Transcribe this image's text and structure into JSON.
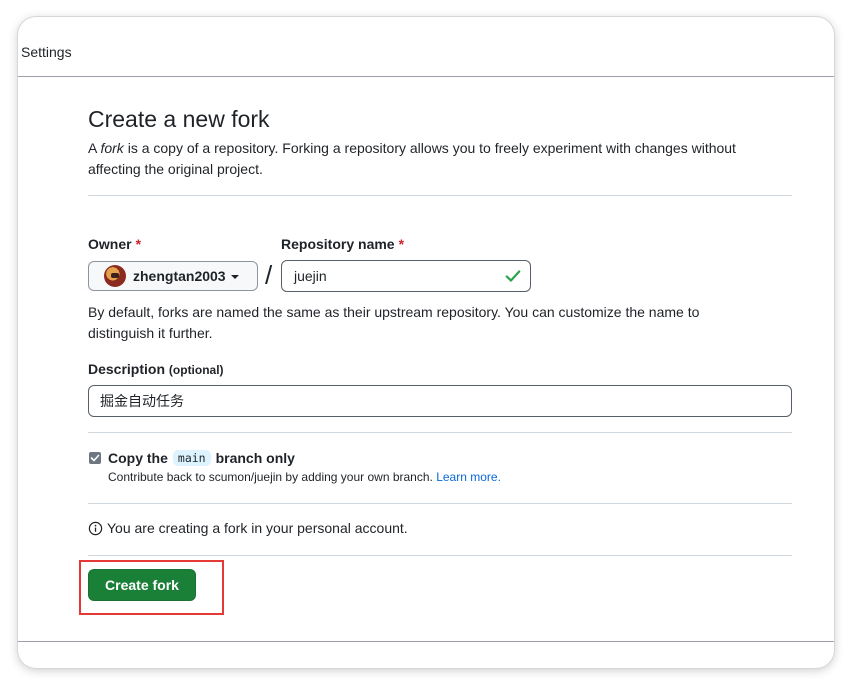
{
  "topbar": {
    "label": "Settings"
  },
  "form": {
    "title": "Create a new fork",
    "lead_prefix": "A ",
    "lead_em": "fork",
    "lead_rest": " is a copy of a repository. Forking a repository allows you to freely experiment with changes without affecting the original project.",
    "owner_label": "Owner",
    "repo_label": "Repository name",
    "required_mark": "*",
    "owner_value": "zhengtan2003",
    "separator": "/",
    "repo_value": "juejin",
    "hint": "By default, forks are named the same as their upstream repository. You can customize the name to distinguish it further.",
    "description_label": "Description",
    "description_optional": "(optional)",
    "description_value": "掘金自动任务",
    "copy_label_prefix": "Copy the",
    "copy_branch": "main",
    "copy_label_suffix": "branch only",
    "copy_note": "Contribute back to scumon/juejin by adding your own branch.",
    "learn_more": "Learn more.",
    "info_text": "You are creating a fork in your personal account.",
    "submit_label": "Create fork"
  },
  "colors": {
    "primary_button": "#1a7f37",
    "required": "#cf222e",
    "link": "#0969da",
    "highlight": "#e53935",
    "check": "#2da44e"
  },
  "icons": {
    "valid": "check-icon",
    "info": "info-icon",
    "caret": "caret-down-icon",
    "checkbox": "checkbox-checked-icon"
  }
}
